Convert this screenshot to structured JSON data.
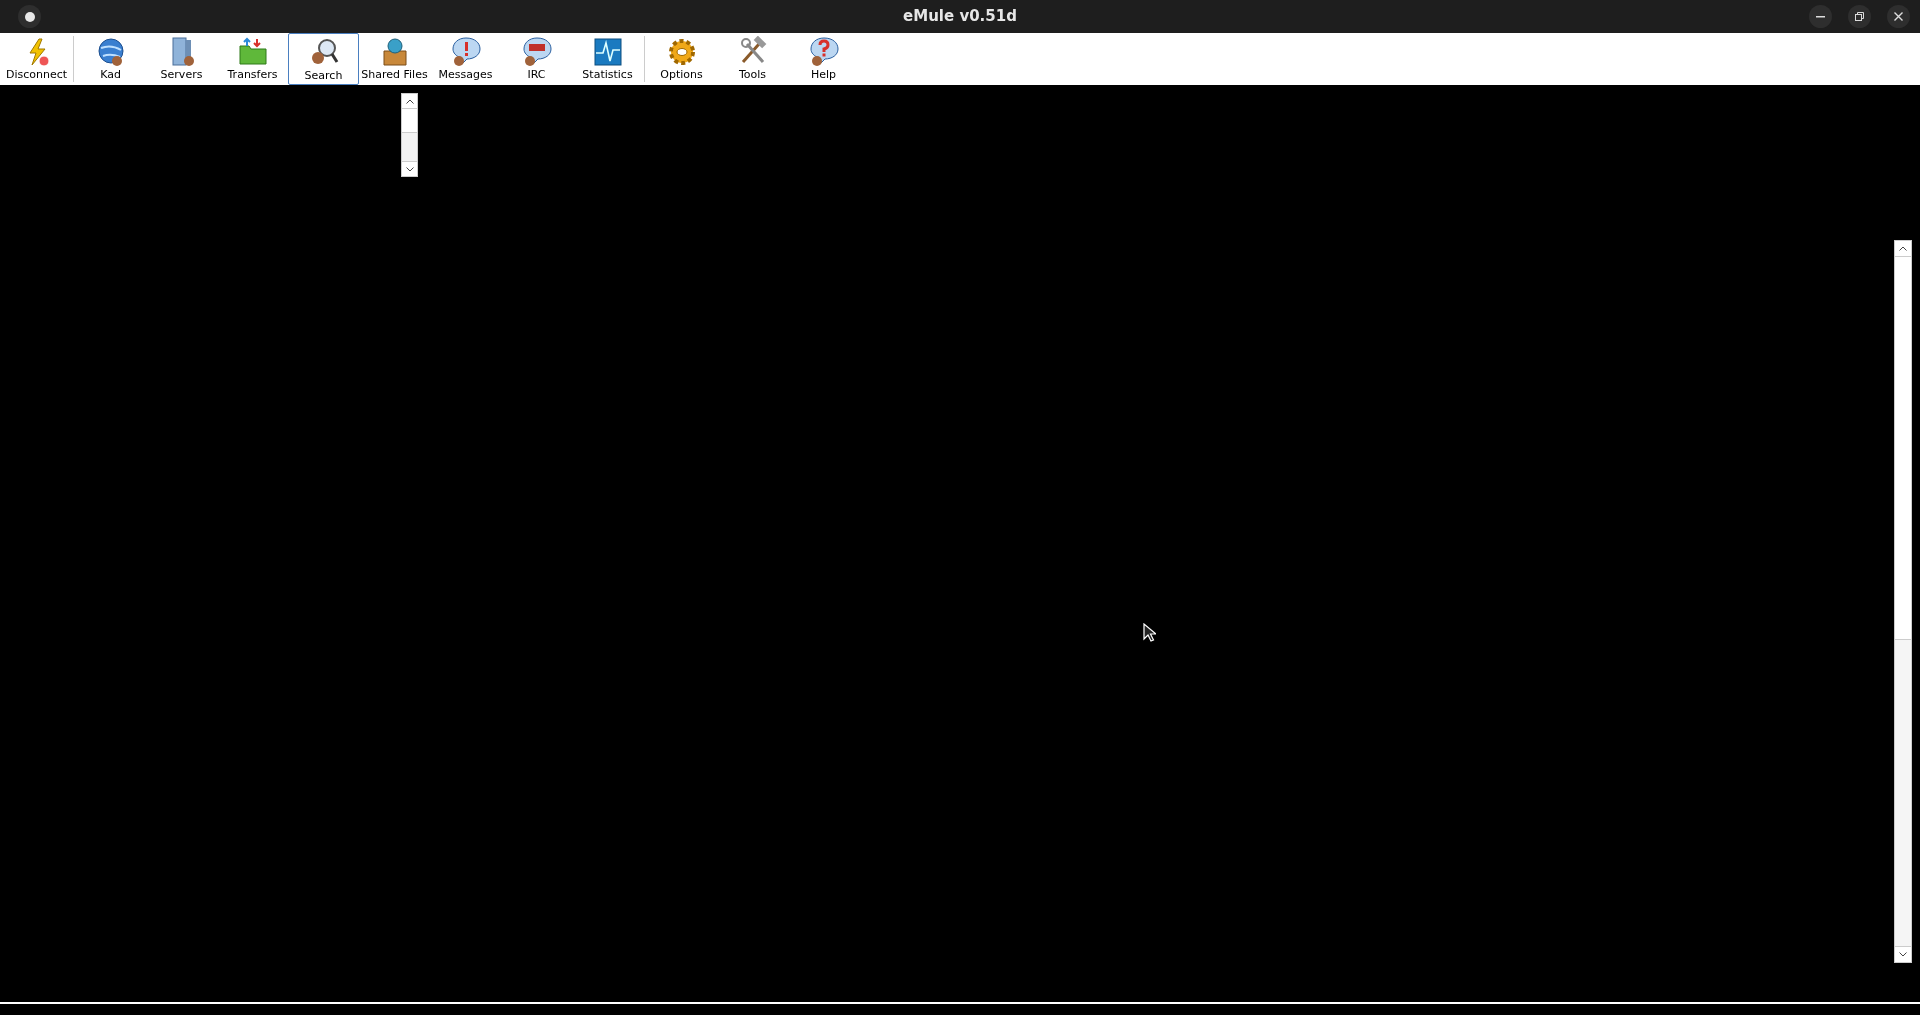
{
  "window": {
    "title": "eMule v0.51d"
  },
  "toolbar": {
    "groups": [
      [
        {
          "label": "Disconnect",
          "selected": false
        }
      ],
      [
        {
          "label": "Kad",
          "selected": false
        },
        {
          "label": "Servers",
          "selected": false
        },
        {
          "label": "Transfers",
          "selected": false
        },
        {
          "label": "Search",
          "selected": true
        },
        {
          "label": "Shared Files",
          "selected": false
        },
        {
          "label": "Messages",
          "selected": false
        },
        {
          "label": "IRC",
          "selected": false
        },
        {
          "label": "Statistics",
          "selected": false
        }
      ],
      [
        {
          "label": "Options",
          "selected": false
        },
        {
          "label": "Tools",
          "selected": false
        },
        {
          "label": "Help",
          "selected": false
        }
      ]
    ]
  }
}
